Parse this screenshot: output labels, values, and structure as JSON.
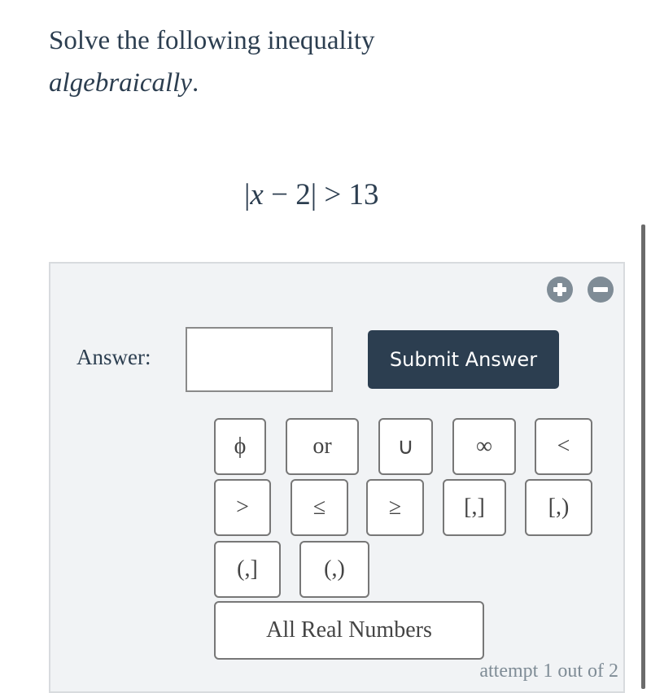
{
  "question": {
    "line1": "Solve the following inequality",
    "line2_italic": "algebraically",
    "line2_end": "."
  },
  "inequality": {
    "abs_open": "|",
    "variable": "x",
    "minus": " − ",
    "constant": "2",
    "abs_close": "|",
    "operator": " > ",
    "rhs": "13"
  },
  "controls": {
    "add_icon": "plus-circle-icon",
    "remove_icon": "minus-circle-icon"
  },
  "answer": {
    "label": "Answer:",
    "value": "",
    "placeholder": ""
  },
  "submit_label": "Submit Answer",
  "keypad": [
    {
      "label": "ϕ",
      "name": "empty-set"
    },
    {
      "label": "or",
      "name": "or"
    },
    {
      "label": "∪",
      "name": "union"
    },
    {
      "label": "∞",
      "name": "infinity"
    },
    {
      "label": "<",
      "name": "less-than"
    },
    {
      "label": ">",
      "name": "greater-than"
    },
    {
      "label": "≤",
      "name": "less-equal"
    },
    {
      "label": "≥",
      "name": "greater-equal"
    },
    {
      "label": "[,]",
      "name": "closed-interval"
    },
    {
      "label": "[,)",
      "name": "closed-open-interval"
    },
    {
      "label": "(,]",
      "name": "open-closed-interval"
    },
    {
      "label": "(,)",
      "name": "open-interval"
    },
    {
      "label": "All Real Numbers",
      "name": "all-real-numbers"
    }
  ],
  "attempt_text": "attempt 1 out of 2",
  "colors": {
    "text": "#2c3e50",
    "button_bg": "#2c3e50",
    "panel_bg": "#f1f3f5",
    "icon": "#7f8c96"
  }
}
